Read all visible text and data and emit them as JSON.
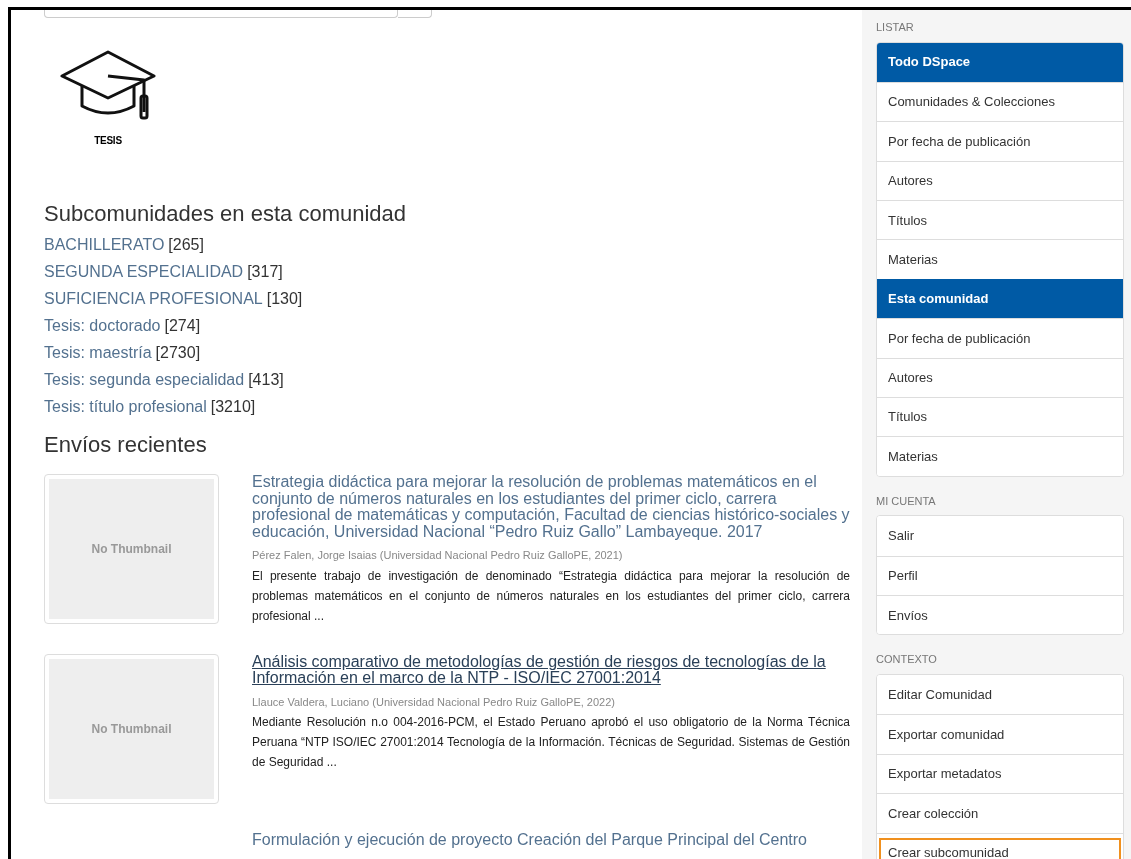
{
  "logo": {
    "caption": "TESIS"
  },
  "subcommunities": {
    "heading": "Subcomunidades en esta comunidad",
    "items": [
      {
        "name": "BACHILLERATO",
        "count": "[265]"
      },
      {
        "name": "SEGUNDA ESPECIALIDAD",
        "count": "[317]"
      },
      {
        "name": "SUFICIENCIA PROFESIONAL",
        "count": "[130]"
      },
      {
        "name": "Tesis: doctorado",
        "count": "[274]"
      },
      {
        "name": "Tesis: maestría",
        "count": "[2730]"
      },
      {
        "name": "Tesis: segunda especialidad",
        "count": "[413]"
      },
      {
        "name": "Tesis: título profesional",
        "count": "[3210]"
      }
    ]
  },
  "recent": {
    "heading": "Envíos recientes",
    "items": [
      {
        "thumbnail": "No Thumbnail",
        "title": "Estrategia didáctica para mejorar la resolución de problemas matemáticos en el conjunto de números naturales en los estudiantes del primer ciclo, carrera profesional de matemáticas y computación, Facultad de ciencias histórico-sociales y educación, Universidad Nacional “Pedro Ruiz Gallo” Lambayeque. 2017",
        "hovered": false,
        "meta": "Pérez Falen, Jorge Isaias (Universidad Nacional Pedro Ruiz GalloPE, 2021)",
        "abstract": "El presente trabajo de investigación de denominado “Estrategia didáctica para mejorar la resolución de problemas matemáticos en el conjunto de números naturales en los estudiantes del primer ciclo, carrera profesional ..."
      },
      {
        "thumbnail": "No Thumbnail",
        "title": "Análisis comparativo de metodologías de gestión de riesgos de tecnologías de la Información en el marco de la NTP - ISO/IEC 27001:2014",
        "hovered": true,
        "meta": "Llauce Valdera, Luciano (Universidad Nacional Pedro Ruiz GalloPE, 2022)",
        "abstract": "Mediante Resolución n.o 004-2016-PCM, el Estado Peruano aprobó el uso obligatorio de la Norma Técnica Peruana “NTP ISO/IEC 27001:2014 Tecnología de la Información. Técnicas de Seguridad. Sistemas de Gestión de Seguridad ..."
      },
      {
        "title": "Formulación y ejecución de proyecto Creación del Parque Principal del Centro",
        "hovered": false
      }
    ]
  },
  "sidebar": [
    {
      "label": "LISTAR",
      "items": [
        {
          "label": "Todo DSpace",
          "selected": true,
          "focused": false
        },
        {
          "label": "Comunidades & Colecciones",
          "selected": false,
          "focused": false
        },
        {
          "label": "Por fecha de publicación",
          "selected": false,
          "focused": false
        },
        {
          "label": "Autores",
          "selected": false,
          "focused": false
        },
        {
          "label": "Títulos",
          "selected": false,
          "focused": false
        },
        {
          "label": "Materias",
          "selected": false,
          "focused": false
        },
        {
          "label": "Esta comunidad",
          "selected": true,
          "focused": false
        },
        {
          "label": "Por fecha de publicación",
          "selected": false,
          "focused": false
        },
        {
          "label": "Autores",
          "selected": false,
          "focused": false
        },
        {
          "label": "Títulos",
          "selected": false,
          "focused": false
        },
        {
          "label": "Materias",
          "selected": false,
          "focused": false
        }
      ]
    },
    {
      "label": "MI CUENTA",
      "items": [
        {
          "label": "Salir",
          "selected": false,
          "focused": false
        },
        {
          "label": "Perfil",
          "selected": false,
          "focused": false
        },
        {
          "label": "Envíos",
          "selected": false,
          "focused": false
        }
      ]
    },
    {
      "label": "CONTEXTO",
      "items": [
        {
          "label": "Editar Comunidad",
          "selected": false,
          "focused": false
        },
        {
          "label": "Exportar comunidad",
          "selected": false,
          "focused": false
        },
        {
          "label": "Exportar metadatos",
          "selected": false,
          "focused": false
        },
        {
          "label": "Crear colección",
          "selected": false,
          "focused": false
        },
        {
          "label": "Crear subcomunidad",
          "selected": false,
          "focused": true
        }
      ]
    }
  ]
}
